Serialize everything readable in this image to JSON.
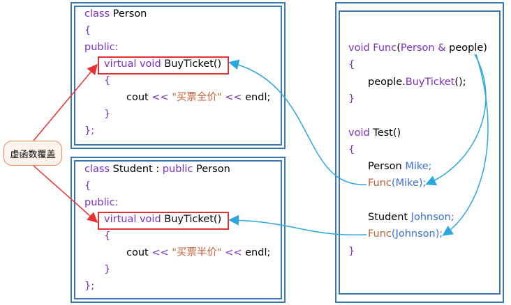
{
  "person_class": {
    "lines": [
      [
        {
          "t": "class ",
          "c": "kw"
        },
        {
          "t": "Person",
          "c": "plain"
        }
      ],
      [
        {
          "t": "{",
          "c": "br"
        }
      ],
      [
        {
          "t": "public:",
          "c": "kw"
        }
      ],
      [
        {
          "t": "virtual void ",
          "c": "kw"
        },
        {
          "t": "BuyTicket()",
          "c": "plain"
        }
      ],
      [
        {
          "t": "{",
          "c": "br"
        }
      ],
      [
        {
          "t": "cout ",
          "c": "plain"
        },
        {
          "t": "<< ",
          "c": "op"
        },
        {
          "t": "\"买票全价\"",
          "c": "str"
        },
        {
          "t": " << ",
          "c": "op"
        },
        {
          "t": "endl;",
          "c": "plain"
        }
      ],
      [
        {
          "t": "}",
          "c": "br"
        }
      ],
      [
        {
          "t": "};",
          "c": "br"
        }
      ]
    ]
  },
  "student_class": {
    "lines": [
      [
        {
          "t": "class ",
          "c": "kw"
        },
        {
          "t": "Student : ",
          "c": "plain"
        },
        {
          "t": "public ",
          "c": "kw"
        },
        {
          "t": "Person",
          "c": "plain"
        }
      ],
      [
        {
          "t": "{",
          "c": "br"
        }
      ],
      [
        {
          "t": "public:",
          "c": "kw"
        }
      ],
      [
        {
          "t": "virtual void ",
          "c": "kw"
        },
        {
          "t": "BuyTicket()",
          "c": "plain"
        }
      ],
      [
        {
          "t": "{",
          "c": "br"
        }
      ],
      [
        {
          "t": "cout ",
          "c": "plain"
        },
        {
          "t": "<< ",
          "c": "op"
        },
        {
          "t": "\"买票半价\"",
          "c": "str"
        },
        {
          "t": " << ",
          "c": "op"
        },
        {
          "t": "endl;",
          "c": "plain"
        }
      ],
      [
        {
          "t": "}",
          "c": "br"
        }
      ],
      [
        {
          "t": "};",
          "c": "br"
        }
      ]
    ]
  },
  "test_code": {
    "lines": [
      [
        {
          "t": "void ",
          "c": "kw"
        },
        {
          "t": "Func",
          "c": "fn"
        },
        {
          "t": "(",
          "c": "plain"
        },
        {
          "t": "Person ",
          "c": "fn"
        },
        {
          "t": "& ",
          "c": "op"
        },
        {
          "t": "people)",
          "c": "plain"
        }
      ],
      [
        {
          "t": "{",
          "c": "br"
        }
      ],
      [
        {
          "t": "people.",
          "c": "plain"
        },
        {
          "t": "BuyTicket",
          "c": "fn"
        },
        {
          "t": "();",
          "c": "plain"
        }
      ],
      [
        {
          "t": "}",
          "c": "br"
        }
      ],
      [
        {
          "t": "",
          "c": "plain"
        }
      ],
      [
        {
          "t": "void ",
          "c": "kw"
        },
        {
          "t": "Test()",
          "c": "plain"
        }
      ],
      [
        {
          "t": "{",
          "c": "br"
        }
      ],
      [
        {
          "t": "Person ",
          "c": "plain"
        },
        {
          "t": "Mike;",
          "c": "tp"
        }
      ],
      [
        {
          "t": "Func",
          "c": "str"
        },
        {
          "t": "(Mike);",
          "c": "tp"
        }
      ],
      [
        {
          "t": "",
          "c": "plain"
        }
      ],
      [
        {
          "t": "Student ",
          "c": "plain"
        },
        {
          "t": "Johnson;",
          "c": "tp"
        }
      ],
      [
        {
          "t": "Func",
          "c": "str"
        },
        {
          "t": "(Johnson);",
          "c": "tp"
        }
      ],
      [
        {
          "t": "}",
          "c": "br"
        }
      ]
    ]
  },
  "bubble_label": "虚函数覆盖",
  "colors": {
    "frame": "#3c78b4",
    "highlight_box": "#e03030",
    "arrow_cyan": "#29a8e0",
    "arrow_red": "#e83030"
  }
}
